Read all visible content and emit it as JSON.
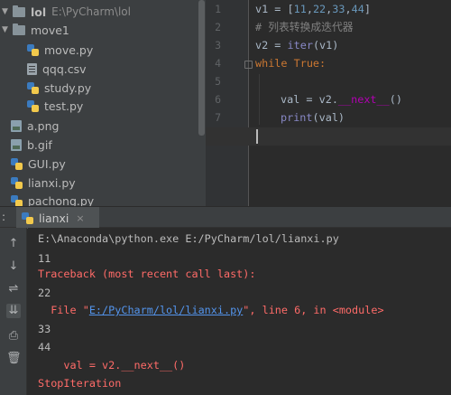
{
  "tree": {
    "root_name": "lol",
    "root_path": "E:\\PyCharm\\lol",
    "folder": "move1",
    "children": [
      "move.py",
      "qqq.csv",
      "study.py",
      "test.py"
    ],
    "files": [
      "a.png",
      "b.gif",
      "GUI.py",
      "lianxi.py",
      "pachong.py"
    ]
  },
  "editor": {
    "line_numbers": [
      "1",
      "2",
      "3",
      "4",
      "5",
      "6",
      "7",
      "8"
    ],
    "l1_a": "v1 = [",
    "l1_n1": "11",
    "l1_c1": ",",
    "l1_n2": "22",
    "l1_c2": ",",
    "l1_n3": "33",
    "l1_c3": ",",
    "l1_n4": "44",
    "l1_b": "]",
    "l2": "# 列表转换成迭代器",
    "l3_a": "v2 = ",
    "l3_fn": "iter",
    "l3_b": "(v1)",
    "l4_kw": "while",
    "l4_b": " True:",
    "l6_a": "val = v2.",
    "l6_magic": "__next__",
    "l6_b": "()",
    "l7_fn": "print",
    "l7_b": "(val)"
  },
  "run": {
    "colon": ":",
    "tab_label": "lianxi",
    "tab_close": "×",
    "toolbar_icons": [
      "arrow-up-icon",
      "arrow-down-icon",
      "soft-wrap-icon",
      "scroll-to-end-icon",
      "print-icon",
      "trash-icon"
    ],
    "console": {
      "cmd": "E:\\Anaconda\\python.exe E:/PyCharm/lol/lianxi.py",
      "o1": "11",
      "tb_head": "Traceback (most recent call last):",
      "o2": "22",
      "file_pre": "  File \"",
      "file_link": "E:/PyCharm/lol/lianxi.py",
      "file_post": "\", line 6, in <module>",
      "o3": "33",
      "o4": "44",
      "src_line": "    val = v2.__next__()",
      "exc": "StopIteration"
    }
  },
  "colors": {
    "keyword": "#cc7832",
    "number": "#6897bb",
    "error": "#ff6b68",
    "link": "#5394ec",
    "magic": "#b200b2"
  }
}
